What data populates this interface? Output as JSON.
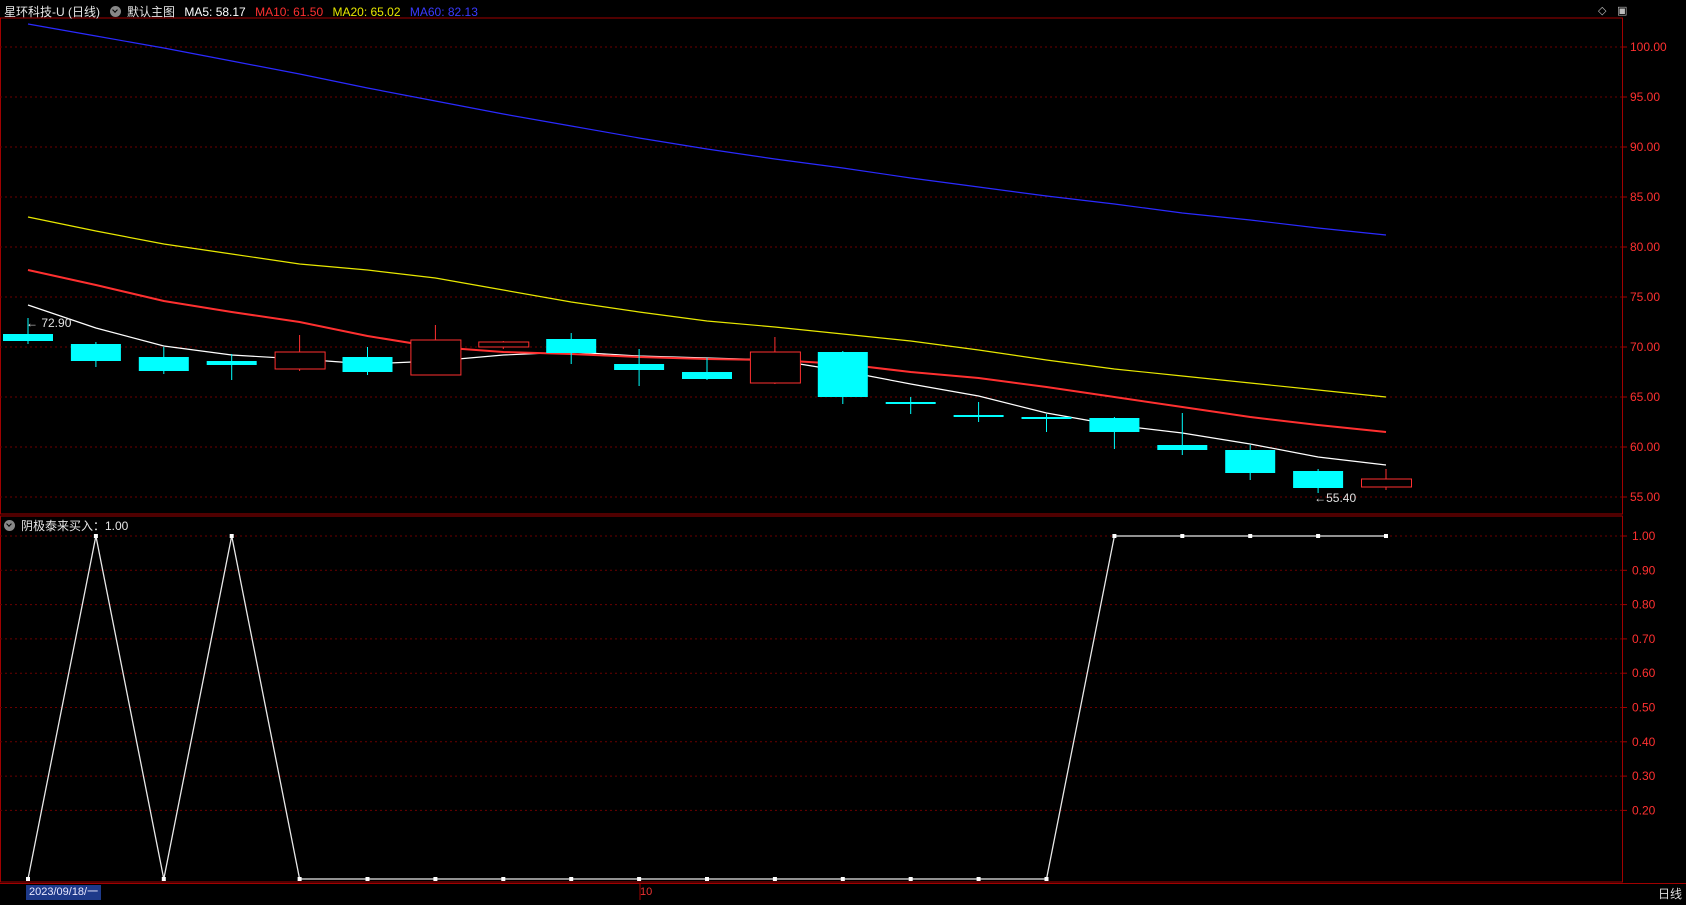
{
  "header": {
    "stock_name": "星环科技-U (日线)",
    "main_chart_label": "默认主图",
    "ma_items": [
      {
        "label": "MA5: 58.17",
        "color": "#ffffff"
      },
      {
        "label": "MA10: 61.50",
        "color": "#ff3030"
      },
      {
        "label": "MA20: 65.02",
        "color": "#e8e800"
      },
      {
        "label": "MA60: 82.13",
        "color": "#2a2aff"
      }
    ]
  },
  "indicator_header": {
    "label": "阴极泰来买入：1.00"
  },
  "footer": {
    "date_label": "2023/09/18/一",
    "month_label": "10",
    "period_label": "日线"
  },
  "colors": {
    "up": "#ff3030",
    "down": "#00ffff",
    "grid": "#6b0000",
    "axis_text": "#ff3030",
    "frame": "#a00000"
  },
  "chart_data": [
    {
      "type": "candlestick",
      "y_ticks": [
        "100.00",
        "95.00",
        "90.00",
        "85.00",
        "80.00",
        "75.00",
        "70.00",
        "65.00",
        "60.00",
        "55.00"
      ],
      "ylim": [
        53.5,
        104.5
      ],
      "high_label": "72.90",
      "low_label": "55.40",
      "candles": [
        {
          "o": 71.3,
          "c": 70.6,
          "h": 72.9,
          "l": 70.3
        },
        {
          "o": 70.3,
          "c": 68.6,
          "h": 70.5,
          "l": 68.0
        },
        {
          "o": 69.0,
          "c": 67.6,
          "h": 70.0,
          "l": 67.3
        },
        {
          "o": 68.6,
          "c": 68.2,
          "h": 69.3,
          "l": 66.7
        },
        {
          "o": 67.8,
          "c": 69.5,
          "h": 71.2,
          "l": 67.6
        },
        {
          "o": 69.0,
          "c": 67.5,
          "h": 70.0,
          "l": 67.2
        },
        {
          "o": 67.2,
          "c": 70.7,
          "h": 72.2,
          "l": 67.2
        },
        {
          "o": 70.0,
          "c": 70.5,
          "h": 70.6,
          "l": 69.8
        },
        {
          "o": 70.8,
          "c": 69.4,
          "h": 71.4,
          "l": 68.3
        },
        {
          "o": 68.3,
          "c": 67.7,
          "h": 69.8,
          "l": 66.1
        },
        {
          "o": 67.5,
          "c": 66.8,
          "h": 68.9,
          "l": 66.7
        },
        {
          "o": 66.4,
          "c": 69.5,
          "h": 71.0,
          "l": 66.3
        },
        {
          "o": 69.5,
          "c": 65.0,
          "h": 69.6,
          "l": 64.3
        },
        {
          "o": 64.5,
          "c": 64.5,
          "h": 65.0,
          "l": 63.3
        },
        {
          "o": 63.2,
          "c": 63.0,
          "h": 64.5,
          "l": 62.5
        },
        {
          "o": 63.0,
          "c": 62.8,
          "h": 63.3,
          "l": 61.5
        },
        {
          "o": 62.9,
          "c": 61.5,
          "h": 63.0,
          "l": 59.8
        },
        {
          "o": 60.2,
          "c": 59.7,
          "h": 63.4,
          "l": 59.2
        },
        {
          "o": 59.7,
          "c": 57.4,
          "h": 60.2,
          "l": 56.7
        },
        {
          "o": 57.6,
          "c": 55.9,
          "h": 57.8,
          "l": 55.4
        },
        {
          "o": 56.0,
          "c": 56.8,
          "h": 57.8,
          "l": 55.7
        }
      ],
      "series": [
        {
          "name": "MA5",
          "color": "#ffffff",
          "values": [
            74.2,
            71.9,
            70.1,
            69.2,
            68.8,
            68.3,
            68.6,
            69.2,
            69.5,
            69.1,
            68.9,
            68.7,
            67.6,
            66.3,
            65.1,
            63.4,
            62.2,
            61.4,
            60.3,
            59.0,
            58.2
          ]
        },
        {
          "name": "MA10",
          "color": "#ff3030",
          "values": [
            77.7,
            76.2,
            74.6,
            73.5,
            72.5,
            71.1,
            70.0,
            69.5,
            69.3,
            69.0,
            68.8,
            68.7,
            68.3,
            67.5,
            66.9,
            66.0,
            65.0,
            64.0,
            63.0,
            62.2,
            61.5
          ]
        },
        {
          "name": "MA20",
          "color": "#e8e800",
          "values": [
            83.0,
            81.6,
            80.3,
            79.3,
            78.3,
            77.7,
            76.9,
            75.7,
            74.5,
            73.5,
            72.6,
            72.0,
            71.3,
            70.6,
            69.7,
            68.7,
            67.8,
            67.1,
            66.4,
            65.7,
            65.0
          ]
        },
        {
          "name": "MA60",
          "color": "#2a2aff",
          "values": [
            102.3,
            101.1,
            99.9,
            98.6,
            97.3,
            95.9,
            94.6,
            93.3,
            92.1,
            90.9,
            89.8,
            88.8,
            87.9,
            86.9,
            86.0,
            85.1,
            84.3,
            83.4,
            82.7,
            81.9,
            81.2
          ]
        }
      ]
    },
    {
      "type": "line",
      "series_name": "阴极泰来买入",
      "y_ticks": [
        "1.00",
        "0.90",
        "0.80",
        "0.70",
        "0.60",
        "0.50",
        "0.40",
        "0.30",
        "0.20"
      ],
      "ylim": [
        0.0,
        1.0
      ],
      "values": [
        0,
        1,
        0,
        1,
        0,
        0,
        0,
        0,
        0,
        0,
        0,
        0,
        0,
        0,
        0,
        0,
        1,
        1,
        1,
        1,
        1
      ]
    }
  ]
}
